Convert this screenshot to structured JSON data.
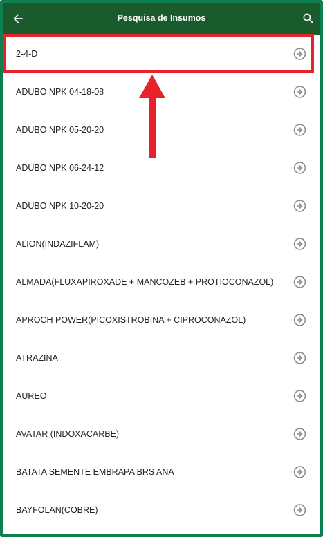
{
  "header": {
    "title": "Pesquisa de Insumos",
    "back_icon": "arrow-left-icon",
    "search_icon": "search-icon"
  },
  "items": [
    {
      "label": "2-4-D"
    },
    {
      "label": "ADUBO NPK 04-18-08"
    },
    {
      "label": "ADUBO NPK 05-20-20"
    },
    {
      "label": "ADUBO NPK 06-24-12"
    },
    {
      "label": "ADUBO NPK 10-20-20"
    },
    {
      "label": "ALION(INDAZIFLAM)"
    },
    {
      "label": "ALMADA(FLUXAPIROXADE + MANCOZEB + PROTIOCONAZOL)"
    },
    {
      "label": "APROCH POWER(PICOXISTROBINA + CIPROCONAZOL)"
    },
    {
      "label": "ATRAZINA"
    },
    {
      "label": "AUREO"
    },
    {
      "label": "AVATAR (INDOXACARBE)"
    },
    {
      "label": "BATATA SEMENTE  EMBRAPA BRS ANA"
    },
    {
      "label": "BAYFOLAN(COBRE)"
    }
  ],
  "colors": {
    "appbar": "#1a5b2d",
    "frame": "#0e7f4e",
    "annotation": "#e8222b",
    "chevron_icon": "#8a8a8a"
  }
}
